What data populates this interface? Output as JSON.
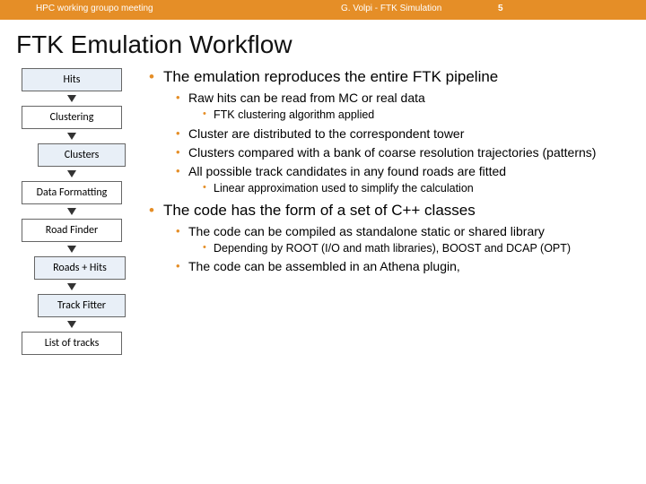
{
  "header": {
    "left": "HPC working groupo meeting",
    "center": "G. Volpi - FTK Simulation",
    "pageNumber": "5"
  },
  "title": "FTK Emulation Workflow",
  "diagram": {
    "boxes": [
      "Hits",
      "Clustering",
      "Clusters",
      "Data Formatting",
      "Road Finder",
      "Roads + Hits",
      "Track Fitter",
      "List of tracks"
    ]
  },
  "bullets": {
    "l1a": "The emulation reproduces the entire FTK pipeline",
    "l2a": "Raw hits can be read from MC or real data",
    "l3a": "FTK clustering algorithm applied",
    "l2b": "Cluster are distributed to the correspondent tower",
    "l2c": "Clusters compared with a bank of coarse resolution trajectories (patterns)",
    "l2d": "All possible track candidates in any found roads are fitted",
    "l3b": "Linear approximation used to simplify the calculation",
    "l1b": "The code has the form of a set of C++ classes",
    "l2e": "The code can be compiled as standalone static or shared library",
    "l3c": "Depending by ROOT (I/O and math libraries), BOOST and DCAP (OPT)",
    "l2f": "The code can be assembled in an Athena plugin,"
  }
}
